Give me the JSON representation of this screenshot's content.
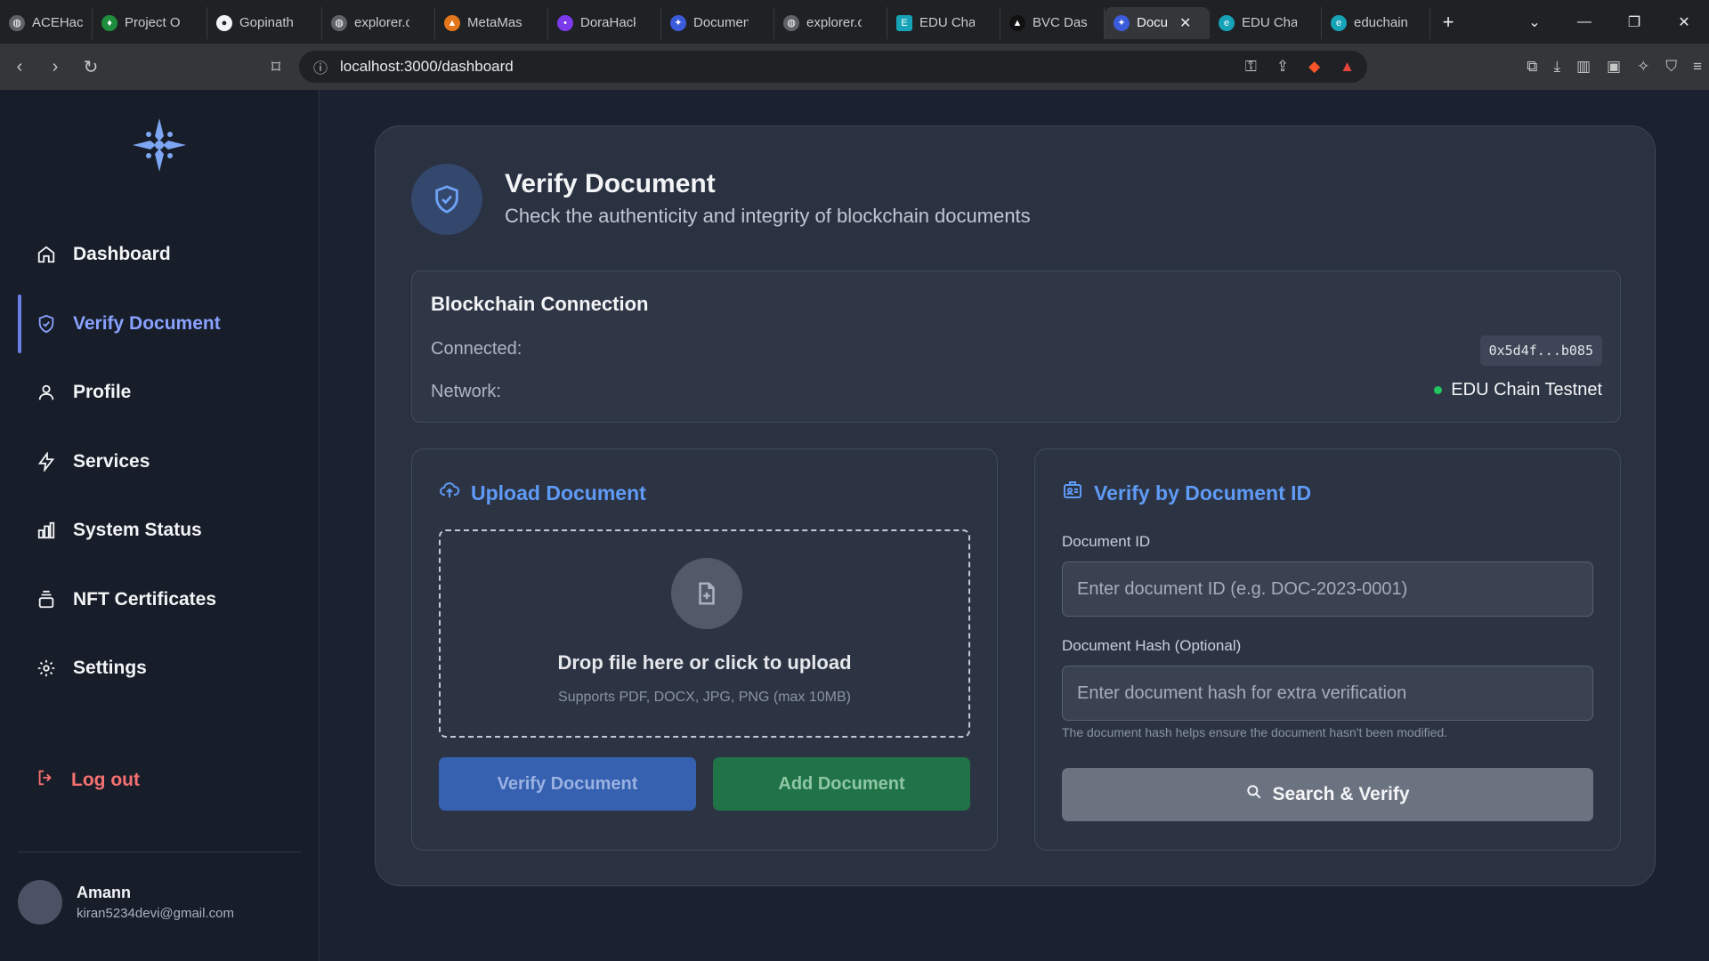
{
  "browser": {
    "tabs": [
      {
        "label": "ACEHack",
        "icon": "globe-icon",
        "color": "#5f6368"
      },
      {
        "label": "Project O",
        "icon": "leaf-icon",
        "color": "#1e8e3e"
      },
      {
        "label": "Gopinath",
        "icon": "github-icon",
        "color": "#202124"
      },
      {
        "label": "explorer.c",
        "icon": "globe-icon",
        "color": "#5f6368"
      },
      {
        "label": "MetaMas",
        "icon": "fox-icon",
        "color": "#e2761b"
      },
      {
        "label": "DoraHack",
        "icon": "dorahacks-icon",
        "color": "#7c3aed"
      },
      {
        "label": "Documen",
        "icon": "app-icon",
        "color": "#3b5bdb"
      },
      {
        "label": "explorer.c",
        "icon": "globe-icon",
        "color": "#5f6368"
      },
      {
        "label": "EDU Cha",
        "icon": "edu-icon",
        "color": "#16a3b8"
      },
      {
        "label": "BVC Dash",
        "icon": "triangle-icon",
        "color": "#111111"
      },
      {
        "label": "Docu",
        "icon": "app-icon",
        "color": "#3b5bdb",
        "active": true
      },
      {
        "label": "EDU Chai",
        "icon": "edu-icon",
        "color": "#16a3b8"
      },
      {
        "label": "educhain",
        "icon": "edu-icon",
        "color": "#16a3b8"
      }
    ],
    "url": "localhost:3000/dashboard"
  },
  "sidebar": {
    "items": [
      {
        "label": "Dashboard",
        "icon": "home-icon"
      },
      {
        "label": "Verify Document",
        "icon": "shield-check-icon",
        "active": true
      },
      {
        "label": "Profile",
        "icon": "user-icon"
      },
      {
        "label": "Services",
        "icon": "lightning-icon"
      },
      {
        "label": "System Status",
        "icon": "bar-chart-icon"
      },
      {
        "label": "NFT Certificates",
        "icon": "layers-icon"
      },
      {
        "label": "Settings",
        "icon": "gear-icon"
      }
    ],
    "logout_label": "Log out",
    "user": {
      "name": "Amann",
      "email": "kiran5234devi@gmail.com"
    }
  },
  "header": {
    "title": "Verify Document",
    "subtitle": "Check the authenticity and integrity of blockchain documents"
  },
  "connection": {
    "title": "Blockchain Connection",
    "connected_label": "Connected:",
    "address": "0x5d4f...b085",
    "network_label": "Network:",
    "network": "EDU Chain Testnet",
    "status_color": "#22c55e"
  },
  "upload": {
    "title": "Upload Document",
    "drop_title": "Drop file here or click to upload",
    "drop_sub": "Supports PDF, DOCX, JPG, PNG (max 10MB)",
    "verify_label": "Verify Document",
    "add_label": "Add Document"
  },
  "verify_id": {
    "title": "Verify by Document ID",
    "id_label": "Document ID",
    "id_placeholder": "Enter document ID (e.g. DOC-2023-0001)",
    "hash_label": "Document Hash (Optional)",
    "hash_placeholder": "Enter document hash for extra verification",
    "hint": "The document hash helps ensure the document hasn't been modified.",
    "search_label": "Search & Verify"
  },
  "colors": {
    "accent": "#5f9bf6",
    "active_nav": "#8aa2ff",
    "verify_button": "#3660b0",
    "add_button": "#207346",
    "logout": "#f87171"
  }
}
